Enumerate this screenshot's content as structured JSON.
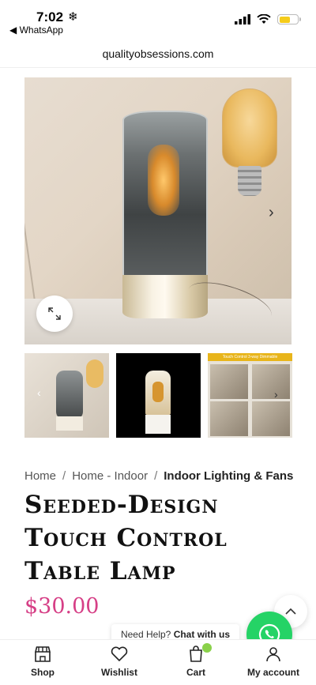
{
  "status": {
    "time": "7:02",
    "back_app": "◀ WhatsApp"
  },
  "browser": {
    "url": "qualityobsessions.com"
  },
  "breadcrumb": {
    "items": [
      "Home",
      "Home - Indoor",
      "Indoor Lighting & Fans"
    ]
  },
  "product": {
    "title": "Seeded-Design Touch Control Table Lamp",
    "price": "$30.00",
    "thumbnail_3_caption": "Touch Control 3-way Dimmable"
  },
  "help": {
    "prompt": "Need Help?",
    "link": "Chat with us"
  },
  "bottom_nav": {
    "items": [
      {
        "label": "Shop",
        "icon": "shop-icon"
      },
      {
        "label": "Wishlist",
        "icon": "heart-icon"
      },
      {
        "label": "Cart",
        "icon": "cart-icon"
      },
      {
        "label": "My account",
        "icon": "user-icon"
      }
    ]
  },
  "colors": {
    "price": "#d63f86",
    "whatsapp": "#25d366",
    "battery": "#f5cc1b"
  }
}
